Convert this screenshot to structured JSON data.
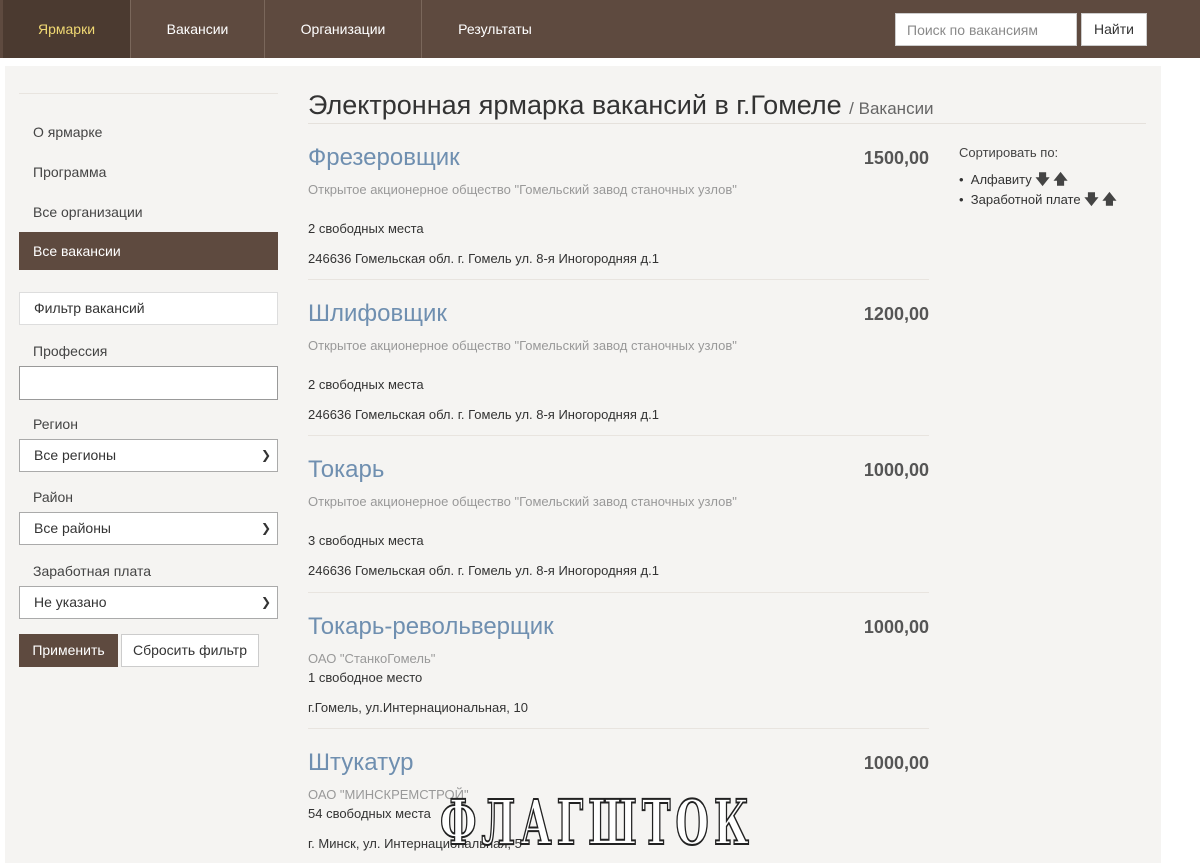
{
  "nav": {
    "items": [
      "Ярмарки",
      "Вакансии",
      "Организации",
      "Результаты"
    ],
    "search_placeholder": "Поиск по вакансиям",
    "search_button": "Найти"
  },
  "sidebar": {
    "links": [
      "О ярмарке",
      "Программа",
      "Все организации",
      "Все вакансии"
    ],
    "filter_title": "Фильтр вакансий",
    "profession_label": "Профессия",
    "profession_value": "",
    "region_label": "Регион",
    "region_value": "Все регионы",
    "district_label": "Район",
    "district_value": "Все районы",
    "salary_label": "Заработная плата",
    "salary_value": "Не указано",
    "apply_button": "Применить",
    "reset_button": "Сбросить фильтр"
  },
  "main": {
    "title": "Электронная ярмарка вакансий в г.Гомеле",
    "crumb": "/ Вакансии",
    "vacancies": [
      {
        "title": "Фрезеровщик",
        "salary": "1500,00",
        "org": "Открытое акционерное общество \"Гомельский завод станочных узлов\"",
        "places": "2 свободных места",
        "address": "246636 Гомельская обл. г. Гомель ул. 8-я Иногородняя д.1"
      },
      {
        "title": "Шлифовщик",
        "salary": "1200,00",
        "org": "Открытое акционерное общество \"Гомельский завод станочных узлов\"",
        "places": "2 свободных места",
        "address": "246636 Гомельская обл. г. Гомель ул. 8-я Иногородняя д.1"
      },
      {
        "title": "Токарь",
        "salary": "1000,00",
        "org": "Открытое акционерное общество \"Гомельский завод станочных узлов\"",
        "places": "3 свободных места",
        "address": "246636 Гомельская обл. г. Гомель ул. 8-я Иногородняя д.1"
      },
      {
        "title": "Токарь-револьверщик",
        "salary": "1000,00",
        "org": "ОАО \"СтанкоГомель\"",
        "places": "1 свободное место",
        "address": "г.Гомель, ул.Интернациональная, 10"
      },
      {
        "title": "Штукатур",
        "salary": "1000,00",
        "org": "ОАО \"МИНСКРЕМСТРОЙ\"",
        "places": "54 свободных места",
        "address": "г. Минск, ул. Интернациональная, 5"
      }
    ]
  },
  "sort": {
    "label": "Сортировать по:",
    "items": [
      "Алфавиту",
      "Заработной плате"
    ]
  },
  "watermark": "ФЛАГШТОК"
}
